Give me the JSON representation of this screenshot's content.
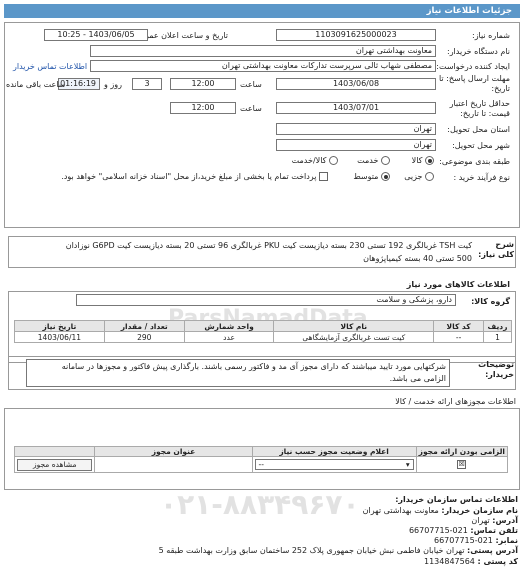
{
  "header": {
    "title": "جزئیات اطلاعات نیاز"
  },
  "form": {
    "need_number_label": "شماره نیاز:",
    "need_number": "1103091625000023",
    "announce_label": "تاریخ و ساعت اعلان عمومی:",
    "announce_value": "1403/06/05 - 10:25",
    "buyer_label": "نام دستگاه خریدار:",
    "buyer_value": "معاونت بهداشتی تهران",
    "creator_label": "ایجاد کننده درخواست:",
    "creator_value": "مصطفی شهاب ثالی سرپرست تدارکات معاونت بهداشتی تهران",
    "contact_link": "اطلاعات تماس خریدار",
    "deadline_label": "مهلت ارسال پاسخ: تا",
    "deadline_label2": "تاریخ:",
    "deadline_date": "1403/06/08",
    "time_label": "ساعت",
    "deadline_time": "12:00",
    "days_value": "3",
    "days_label": "روز و",
    "remain_time": "01:16:19",
    "remain_label": "ساعت باقی مانده",
    "validity_label1": "حداقل تاریخ اعتبار",
    "validity_label2": "قیمت: تا تاریخ:",
    "validity_date": "1403/07/01",
    "validity_time": "12:00",
    "province_label": "استان محل تحویل:",
    "province_value": "تهران",
    "city_label": "شهر محل تحویل:",
    "city_value": "تهران",
    "category_label": "طبقه بندی موضوعی:",
    "cat_goods": "کالا",
    "cat_service": "خدمت",
    "cat_both": "کالا/خدمت",
    "process_label": "نوع فرآیند خرید :",
    "proc_partial": "جزیی",
    "proc_medium": "متوسط",
    "payment_note": "پرداخت تمام یا بخشی از مبلغ خرید،از محل \"اسناد خزانه اسلامی\" خواهد بود."
  },
  "summary": {
    "label": "شرح کلی نیاز:",
    "text_line1": "کیت TSH غربالگری 192 تستی 230 بسته دیازیست کیت PKU غربالگری 96 تستی 20 بسته دیازیست کیت G6PD نوزادان",
    "text_line2": "500 تستی 40 بسته کیمیاپژوهان"
  },
  "goods": {
    "section_title": "اطلاعات کالاهای مورد نیاز",
    "group_label": "گروه کالا:",
    "group_value": "دارو، پزشکی و سلامت",
    "columns": [
      "ردیف",
      "کد کالا",
      "نام کالا",
      "واحد شمارش",
      "تعداد / مقدار",
      "تاریخ نیاز"
    ],
    "rows": [
      [
        "1",
        "--",
        "کیت تست غربالگری آزمایشگاهی",
        "عدد",
        "290",
        "1403/06/11"
      ]
    ]
  },
  "buyer_notes": {
    "label": "توضیحات خریدار:",
    "line1": "شرکتهایی مورد تایید میباشند که دارای مجوز آی مد و فاکتور رسمی باشند. بارگذاری پیش فاکتور و مجوزها در سامانه",
    "line2": "الزامی می باشد."
  },
  "permits": {
    "section_title": "اطلاعات مجوزهای ارائه خدمت / کالا",
    "col_required": "الزامی بودن ارائه مجوز",
    "col_status": "اعلام وضعیت مجوز حسب نیاز",
    "col_title": "عنوان مجوز",
    "col_view": "",
    "status_value": "--",
    "view_button": "مشاهده مجوز"
  },
  "buyer_contact": {
    "section_title": "اطلاعات تماس سازمان خریدار:",
    "org_label": "نام سازمان خریدار:",
    "org_value": "معاونت بهداشتی تهران",
    "address_label": "آدرس:",
    "address_value": "تهران",
    "phone_label": "تلفن تماس:",
    "phone_value": "021-66707715",
    "fax_label": "نمابر:",
    "fax_value": "021-66707715",
    "full_address_label": "آدرس پستی:",
    "full_address_value": "تهران خیابان فاطمی نبش خیابان جمهوری پلاک 252 ساختمان سابق وزارت بهداشت طبقه 5",
    "postal_label": "کد پستی :",
    "postal_value": "1134847564"
  },
  "watermark": {
    "line1": "ParsNamadData",
    "line2": "۰۲۱-۸۸۳۴۹۶۷۰"
  },
  "colors": {
    "header_bg": "#5b97c9",
    "link": "#2255aa"
  }
}
